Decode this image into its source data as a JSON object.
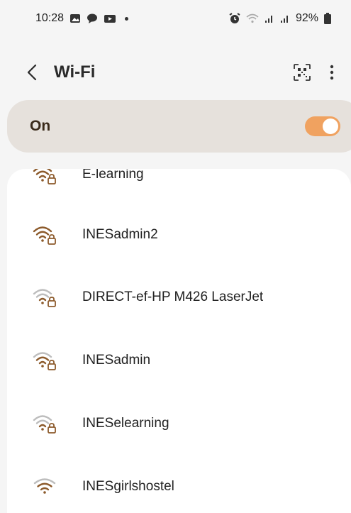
{
  "status_bar": {
    "time": "10:28",
    "battery": "92%"
  },
  "app_bar": {
    "title": "Wi-Fi"
  },
  "wifi_toggle": {
    "label": "On",
    "enabled": true
  },
  "colors": {
    "accent": "#f0a260",
    "icon_brown": "#8c5a2b",
    "icon_gray": "#bdbdbd"
  },
  "networks": [
    {
      "name": "E-learning",
      "secured": true,
      "strength_bars": 3
    },
    {
      "name": "INESadmin2",
      "secured": true,
      "strength_bars": 3
    },
    {
      "name": "DIRECT-ef-HP M426 LaserJet",
      "secured": true,
      "strength_bars": 1
    },
    {
      "name": "INESadmin",
      "secured": true,
      "strength_bars": 2
    },
    {
      "name": "INESelearning",
      "secured": true,
      "strength_bars": 1
    },
    {
      "name": "INESgirlshostel",
      "secured": false,
      "strength_bars": 2
    }
  ]
}
